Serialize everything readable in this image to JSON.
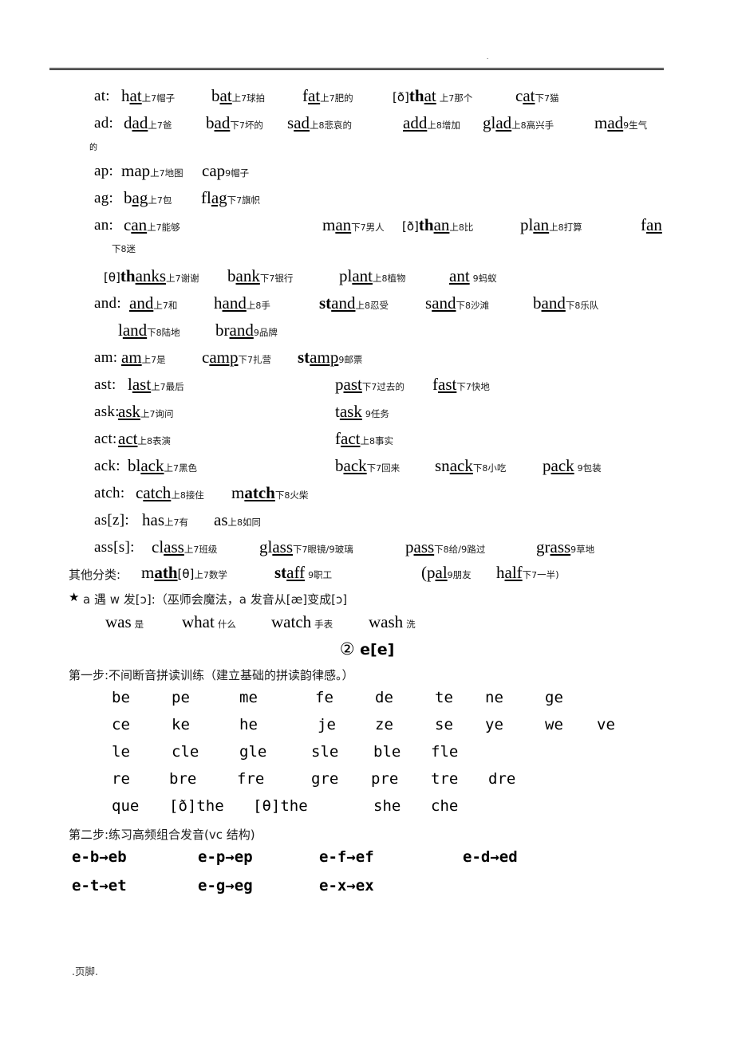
{
  "page": {
    "header_mark": ".",
    "footer_text": ".页脚."
  },
  "groups": [
    {
      "key": "at:",
      "entries": [
        {
          "ipa": "",
          "word_pre": "h",
          "word_core": "at",
          "word_post": "",
          "tone": "上",
          "num": "7",
          "gloss": "帽子"
        },
        {
          "ipa": "",
          "word_pre": "b",
          "word_core": "at",
          "word_post": "",
          "tone": "上",
          "num": "7",
          "gloss": "球拍"
        },
        {
          "ipa": "",
          "word_pre": "f",
          "word_core": "at",
          "word_post": "",
          "tone": "上",
          "num": "7",
          "gloss": "肥的"
        },
        {
          "ipa": "[ð]",
          "word_pre": "th",
          "word_core": "at",
          "word_post": "",
          "bold_pre": true,
          "tone": "上",
          "num": "7",
          "gloss": "那个"
        },
        {
          "ipa": "",
          "word_pre": "c",
          "word_core": "at",
          "word_post": "",
          "tone": "下",
          "num": "7",
          "gloss": "猫"
        }
      ]
    },
    {
      "key": "ad:",
      "entries": [
        {
          "word_pre": "d",
          "word_core": "ad",
          "tone": "上",
          "num": "7",
          "gloss": "爸"
        },
        {
          "word_pre": "b",
          "word_core": "ad",
          "tone": "下",
          "num": "7",
          "gloss": "坏的"
        },
        {
          "word_pre": "s",
          "word_core": "ad",
          "tone": "上",
          "num": "8",
          "gloss": "悲哀的"
        },
        {
          "word_pre": "",
          "word_core": "add",
          "tone": "上",
          "num": "8",
          "gloss": "增加"
        },
        {
          "word_pre": "gl",
          "word_core": "ad",
          "tone": "上",
          "num": "8",
          "gloss": "高兴手"
        },
        {
          "word_pre": "m",
          "word_core": "ad",
          "tone": "",
          "num": "9",
          "gloss": "生气"
        }
      ],
      "wrap_gloss": "的"
    },
    {
      "key": "ap:",
      "entries": [
        {
          "word_pre": "",
          "word_core": "",
          "word_plain": "map",
          "tone": "上",
          "num": "7",
          "gloss": "地图"
        },
        {
          "word_plain": "cap",
          "tone": "",
          "num": "9",
          "gloss": "帽子"
        }
      ]
    },
    {
      "key": "ag:",
      "entries": [
        {
          "word_pre": "b",
          "word_core": "ag",
          "tone": "上",
          "num": "7",
          "gloss": "包"
        },
        {
          "word_pre": "fl",
          "word_core": "ag",
          "tone": "下",
          "num": "7",
          "gloss": "旗帜"
        }
      ]
    },
    {
      "key": "an:",
      "entries": [
        {
          "word_pre": "c",
          "word_core": "an",
          "tone": "上",
          "num": "7",
          "gloss": "能够"
        },
        {
          "word_pre": "m",
          "word_core": "an",
          "tone": "下",
          "num": "7",
          "gloss": "男人"
        },
        {
          "ipa": "[ð]",
          "word_pre": "th",
          "word_core": "an",
          "bold_pre": true,
          "tone": "上",
          "num": "8",
          "gloss": "比"
        },
        {
          "word_pre": "pl",
          "word_core": "an",
          "tone": "上",
          "num": "8",
          "gloss": "打算"
        },
        {
          "word_pre": "f",
          "word_core": "an",
          "tone": "",
          "num": "",
          "gloss": ""
        }
      ],
      "wrap_tone": "下",
      "wrap_num": "8",
      "wrap_gloss": "迷"
    },
    {
      "key": "",
      "entries": [
        {
          "ipa": "[θ]",
          "word_pre": "th",
          "word_core": "anks",
          "bold_pre": true,
          "tone": "上",
          "num": "7",
          "gloss": "谢谢"
        },
        {
          "word_pre": "b",
          "word_core": "ank",
          "tone": "下",
          "num": "7",
          "gloss": "银行"
        },
        {
          "word_pre": "pl",
          "word_core": "ant",
          "tone": "上",
          "num": "8",
          "gloss": "植物"
        },
        {
          "word_pre": "",
          "word_core": "ant",
          "tone": "",
          "num": "9",
          "gloss": "蚂蚁"
        }
      ]
    },
    {
      "key": "and:",
      "entries": [
        {
          "word_pre": "",
          "word_core": "and",
          "tone": "上",
          "num": "7",
          "gloss": "和"
        },
        {
          "word_pre": "h",
          "word_core": "and",
          "tone": "上",
          "num": "8",
          "gloss": "手"
        },
        {
          "word_pre": "st",
          "word_core": "and",
          "bold_pre": true,
          "tone": "上",
          "num": "8",
          "gloss": "忍受"
        },
        {
          "word_pre": "s",
          "word_core": "and",
          "tone": "下",
          "num": "8",
          "gloss": "沙滩"
        },
        {
          "word_pre": "b",
          "word_core": "and",
          "tone": "下",
          "num": "8",
          "gloss": "乐队"
        },
        {
          "word_pre": "l",
          "word_core": "and",
          "tone": "下",
          "num": "8",
          "gloss": "陆地"
        },
        {
          "word_pre": "br",
          "word_core": "and",
          "tone": "",
          "num": "9",
          "gloss": "品牌"
        }
      ]
    },
    {
      "key": "am:",
      "entries": [
        {
          "word_pre": "",
          "word_core": "am",
          "tone": "上",
          "num": "7",
          "gloss": "是"
        },
        {
          "word_pre": "c",
          "word_core": "amp",
          "tone": "下",
          "num": "7",
          "gloss": "扎营"
        },
        {
          "word_pre": "st",
          "word_core": "amp",
          "bold_pre": true,
          "tone": "",
          "num": "9",
          "gloss": "邮票"
        }
      ]
    },
    {
      "key": "ast:",
      "entries": [
        {
          "word_pre": "l",
          "word_core": "ast",
          "tone": "上",
          "num": "7",
          "gloss": "最后"
        },
        {
          "word_pre": "p",
          "word_core": "ast",
          "tone": "下",
          "num": "7",
          "gloss": "过去的"
        },
        {
          "word_pre": "f",
          "word_core": "ast",
          "tone": "下",
          "num": "7",
          "gloss": "快地"
        }
      ]
    },
    {
      "key": "ask:",
      "entries": [
        {
          "word_pre": "",
          "word_core": "ask",
          "tone": "上",
          "num": "7",
          "gloss": "询问"
        },
        {
          "word_pre": "t",
          "word_core": "ask",
          "tone": "",
          "num": "9",
          "gloss": "任务"
        }
      ]
    },
    {
      "key": "act:",
      "entries": [
        {
          "word_pre": "",
          "word_core": "act",
          "tone": "上",
          "num": "8",
          "gloss": "表演"
        },
        {
          "word_pre": "f",
          "word_core": "act",
          "tone": "上",
          "num": "8",
          "gloss": "事实"
        }
      ]
    },
    {
      "key": "ack:",
      "entries": [
        {
          "word_pre": "bl",
          "word_core": "ack",
          "tone": "上",
          "num": "7",
          "gloss": "黑色"
        },
        {
          "word_pre": "b",
          "word_core": "ack",
          "tone": "下",
          "num": "7",
          "gloss": "回来"
        },
        {
          "word_pre": "sn",
          "word_core": "ack",
          "tone": "下",
          "num": "8",
          "gloss": "小吃"
        },
        {
          "word_pre": "p",
          "word_core": "ack",
          "tone": "",
          "num": "9",
          "gloss": "包装"
        }
      ]
    },
    {
      "key": "atch:",
      "entries": [
        {
          "word_pre": "c",
          "word_core": "atch",
          "tone": "上",
          "num": "8",
          "gloss": "接住"
        },
        {
          "word_pre": "m",
          "word_core": "atch",
          "bold_core": true,
          "tone": "下",
          "num": "8",
          "gloss": "火柴"
        }
      ]
    },
    {
      "key": "as[z]:",
      "entries": [
        {
          "word_plain": "has",
          "tone": "上",
          "num": "7",
          "gloss": "有"
        },
        {
          "word_plain": "as",
          "tone": "上",
          "num": "8",
          "gloss": "如同"
        }
      ]
    },
    {
      "key": "ass[s]:",
      "entries": [
        {
          "word_pre": "cl",
          "word_core": "ass",
          "tone": "上",
          "num": "7",
          "gloss": "班级"
        },
        {
          "word_pre": "gl",
          "word_core": "ass",
          "tone": "下",
          "num": "7",
          "gloss": "眼镜/9玻璃"
        },
        {
          "word_pre": "p",
          "word_core": "ass",
          "tone": "下",
          "num": "8",
          "gloss": "给/9路过"
        },
        {
          "word_pre": "gr",
          "word_core": "ass",
          "tone": "",
          "num": "9",
          "gloss": "草地"
        }
      ]
    }
  ],
  "other_line": {
    "label": "其他分类:",
    "entries": [
      {
        "word_pre": "m",
        "word_core": "ath",
        "bold_core": true,
        "ipa_after": "[θ]",
        "tone": "上",
        "num": "7",
        "gloss": "数学"
      },
      {
        "word_pre": "st",
        "word_core": "aff",
        "bold_pre": true,
        "tone": "",
        "num": "9",
        "gloss": "职工"
      },
      {
        "word_pre": "(p",
        "word_core": "al",
        "tone": "",
        "num": "9",
        "gloss": "朋友"
      },
      {
        "word_pre": "h",
        "word_core": "alf",
        "tone": "下",
        "num": "7",
        "gloss": "一半)"
      }
    ]
  },
  "star_rule": {
    "bullet": "★",
    "text": "a 遇 w 发[ɔ]:（巫师会魔法，a 发音从[æ]变成[ɔ]",
    "examples": [
      {
        "word": "was",
        "gloss": "是"
      },
      {
        "word": "what",
        "gloss": "什么"
      },
      {
        "word": "watch",
        "gloss": "手表"
      },
      {
        "word": "wash",
        "gloss": "洗"
      }
    ]
  },
  "section2": {
    "number": "②",
    "title": "e[e]",
    "step1_label": "第一步:不间断音拼读训练（建立基础的拼读韵律感。）",
    "syllable_rows": [
      [
        "be",
        "pe",
        "me",
        "fe",
        "de",
        "te",
        "ne",
        "ge"
      ],
      [
        "ce",
        "ke",
        "he",
        "je",
        "ze",
        "se",
        "ye",
        "we",
        "ve"
      ],
      [
        "le",
        "cle",
        "gle",
        "sle",
        "ble",
        "fle"
      ],
      [
        "re",
        "bre",
        "fre",
        "gre",
        "pre",
        "tre",
        "dre"
      ],
      [
        "que",
        "[ð]the",
        "[θ]the",
        "she",
        "che"
      ]
    ],
    "step2_label": "第二步:练习高频组合发音(vc 结构)",
    "vc_rows": [
      [
        "e-b→eb",
        "e-p→ep",
        "e-f→ef",
        "e-d→ed"
      ],
      [
        "e-t→et",
        "e-g→eg",
        "e-x→ex"
      ]
    ]
  }
}
